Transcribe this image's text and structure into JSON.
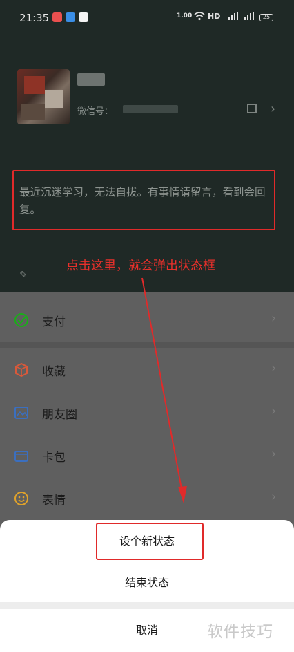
{
  "status_bar": {
    "time": "21:35",
    "net_speed": "1.00",
    "hd_label": "HD",
    "battery": "25"
  },
  "profile": {
    "wechat_id_label": "微信号：",
    "status_text": "最近沉迷学习，无法自拔。有事情请留言，看到会回复。"
  },
  "annotation": "点击这里，就会弹出状态框",
  "menu": {
    "items": [
      {
        "label": "支付",
        "icon": "pay-check-icon"
      },
      {
        "label": "收藏",
        "icon": "favorites-cube-icon"
      },
      {
        "label": "朋友圈",
        "icon": "moments-image-icon"
      },
      {
        "label": "卡包",
        "icon": "card-wallet-icon"
      },
      {
        "label": "表情",
        "icon": "sticker-face-icon"
      }
    ]
  },
  "sheet": {
    "new_status": "设个新状态",
    "end_status": "结束状态",
    "cancel": "取消"
  },
  "watermark": "软件技巧",
  "colors": {
    "highlight": "#e02a2a",
    "annotation": "#e8302b",
    "icon_green": "#1aad19"
  }
}
